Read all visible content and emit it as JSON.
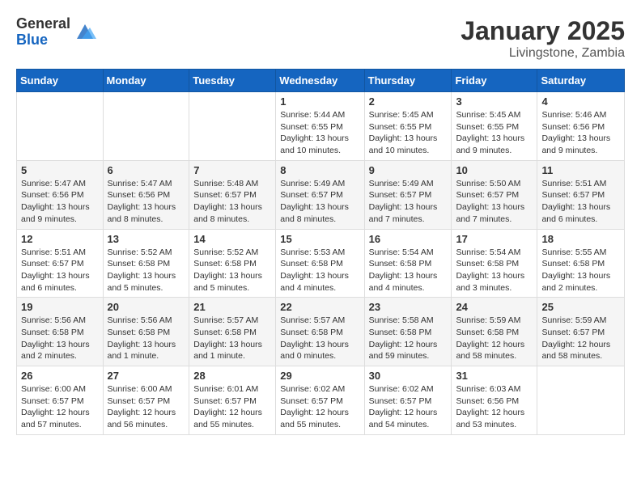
{
  "logo": {
    "general": "General",
    "blue": "Blue"
  },
  "title": "January 2025",
  "location": "Livingstone, Zambia",
  "days_of_week": [
    "Sunday",
    "Monday",
    "Tuesday",
    "Wednesday",
    "Thursday",
    "Friday",
    "Saturday"
  ],
  "weeks": [
    [
      {
        "day": "",
        "info": ""
      },
      {
        "day": "",
        "info": ""
      },
      {
        "day": "",
        "info": ""
      },
      {
        "day": "1",
        "info": "Sunrise: 5:44 AM\nSunset: 6:55 PM\nDaylight: 13 hours and 10 minutes."
      },
      {
        "day": "2",
        "info": "Sunrise: 5:45 AM\nSunset: 6:55 PM\nDaylight: 13 hours and 10 minutes."
      },
      {
        "day": "3",
        "info": "Sunrise: 5:45 AM\nSunset: 6:55 PM\nDaylight: 13 hours and 9 minutes."
      },
      {
        "day": "4",
        "info": "Sunrise: 5:46 AM\nSunset: 6:56 PM\nDaylight: 13 hours and 9 minutes."
      }
    ],
    [
      {
        "day": "5",
        "info": "Sunrise: 5:47 AM\nSunset: 6:56 PM\nDaylight: 13 hours and 9 minutes."
      },
      {
        "day": "6",
        "info": "Sunrise: 5:47 AM\nSunset: 6:56 PM\nDaylight: 13 hours and 8 minutes."
      },
      {
        "day": "7",
        "info": "Sunrise: 5:48 AM\nSunset: 6:57 PM\nDaylight: 13 hours and 8 minutes."
      },
      {
        "day": "8",
        "info": "Sunrise: 5:49 AM\nSunset: 6:57 PM\nDaylight: 13 hours and 8 minutes."
      },
      {
        "day": "9",
        "info": "Sunrise: 5:49 AM\nSunset: 6:57 PM\nDaylight: 13 hours and 7 minutes."
      },
      {
        "day": "10",
        "info": "Sunrise: 5:50 AM\nSunset: 6:57 PM\nDaylight: 13 hours and 7 minutes."
      },
      {
        "day": "11",
        "info": "Sunrise: 5:51 AM\nSunset: 6:57 PM\nDaylight: 13 hours and 6 minutes."
      }
    ],
    [
      {
        "day": "12",
        "info": "Sunrise: 5:51 AM\nSunset: 6:57 PM\nDaylight: 13 hours and 6 minutes."
      },
      {
        "day": "13",
        "info": "Sunrise: 5:52 AM\nSunset: 6:58 PM\nDaylight: 13 hours and 5 minutes."
      },
      {
        "day": "14",
        "info": "Sunrise: 5:52 AM\nSunset: 6:58 PM\nDaylight: 13 hours and 5 minutes."
      },
      {
        "day": "15",
        "info": "Sunrise: 5:53 AM\nSunset: 6:58 PM\nDaylight: 13 hours and 4 minutes."
      },
      {
        "day": "16",
        "info": "Sunrise: 5:54 AM\nSunset: 6:58 PM\nDaylight: 13 hours and 4 minutes."
      },
      {
        "day": "17",
        "info": "Sunrise: 5:54 AM\nSunset: 6:58 PM\nDaylight: 13 hours and 3 minutes."
      },
      {
        "day": "18",
        "info": "Sunrise: 5:55 AM\nSunset: 6:58 PM\nDaylight: 13 hours and 2 minutes."
      }
    ],
    [
      {
        "day": "19",
        "info": "Sunrise: 5:56 AM\nSunset: 6:58 PM\nDaylight: 13 hours and 2 minutes."
      },
      {
        "day": "20",
        "info": "Sunrise: 5:56 AM\nSunset: 6:58 PM\nDaylight: 13 hours and 1 minute."
      },
      {
        "day": "21",
        "info": "Sunrise: 5:57 AM\nSunset: 6:58 PM\nDaylight: 13 hours and 1 minute."
      },
      {
        "day": "22",
        "info": "Sunrise: 5:57 AM\nSunset: 6:58 PM\nDaylight: 13 hours and 0 minutes."
      },
      {
        "day": "23",
        "info": "Sunrise: 5:58 AM\nSunset: 6:58 PM\nDaylight: 12 hours and 59 minutes."
      },
      {
        "day": "24",
        "info": "Sunrise: 5:59 AM\nSunset: 6:58 PM\nDaylight: 12 hours and 58 minutes."
      },
      {
        "day": "25",
        "info": "Sunrise: 5:59 AM\nSunset: 6:57 PM\nDaylight: 12 hours and 58 minutes."
      }
    ],
    [
      {
        "day": "26",
        "info": "Sunrise: 6:00 AM\nSunset: 6:57 PM\nDaylight: 12 hours and 57 minutes."
      },
      {
        "day": "27",
        "info": "Sunrise: 6:00 AM\nSunset: 6:57 PM\nDaylight: 12 hours and 56 minutes."
      },
      {
        "day": "28",
        "info": "Sunrise: 6:01 AM\nSunset: 6:57 PM\nDaylight: 12 hours and 55 minutes."
      },
      {
        "day": "29",
        "info": "Sunrise: 6:02 AM\nSunset: 6:57 PM\nDaylight: 12 hours and 55 minutes."
      },
      {
        "day": "30",
        "info": "Sunrise: 6:02 AM\nSunset: 6:57 PM\nDaylight: 12 hours and 54 minutes."
      },
      {
        "day": "31",
        "info": "Sunrise: 6:03 AM\nSunset: 6:56 PM\nDaylight: 12 hours and 53 minutes."
      },
      {
        "day": "",
        "info": ""
      }
    ]
  ]
}
